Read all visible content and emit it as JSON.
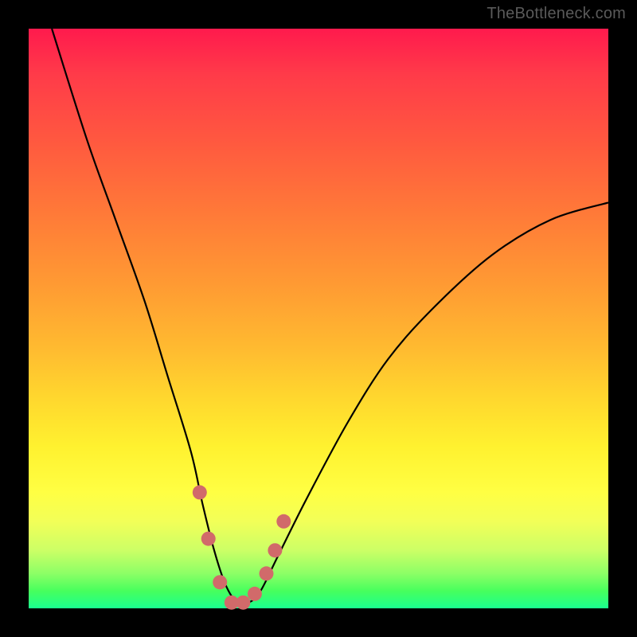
{
  "watermark": "TheBottleneck.com",
  "chart_data": {
    "type": "line",
    "title": "",
    "xlabel": "",
    "ylabel": "",
    "xlim": [
      0,
      100
    ],
    "ylim": [
      0,
      100
    ],
    "series": [
      {
        "name": "bottleneck-curve",
        "x": [
          4,
          10,
          15,
          20,
          24,
          28,
          30,
          32,
          34,
          36,
          38,
          40,
          43,
          48,
          55,
          62,
          70,
          80,
          90,
          100
        ],
        "values": [
          100,
          81,
          67,
          53,
          40,
          27,
          18,
          10,
          4,
          1,
          1,
          3,
          9,
          19,
          32,
          43,
          52,
          61,
          67,
          70
        ]
      }
    ],
    "markers": {
      "name": "highlighted-points",
      "color": "#d16a6a",
      "x": [
        29.5,
        31.0,
        33.0,
        35.0,
        37.0,
        39.0,
        41.0,
        42.5,
        44.0
      ],
      "values": [
        20.0,
        12.0,
        4.5,
        1.0,
        1.0,
        2.5,
        6.0,
        10.0,
        15.0
      ]
    },
    "background_gradient": {
      "top": "#ff1a4d",
      "mid": "#ffff43",
      "bottom": "#1aff8f"
    }
  }
}
